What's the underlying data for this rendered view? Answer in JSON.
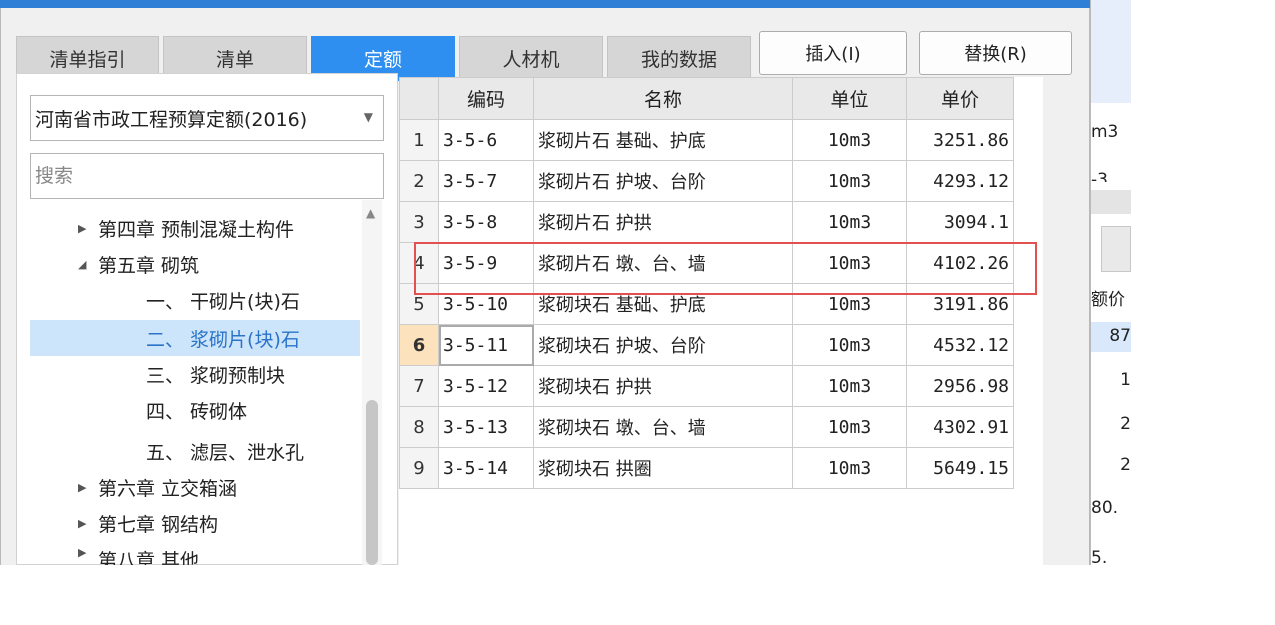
{
  "tabs": [
    {
      "label": "清单指引",
      "active": false
    },
    {
      "label": "清单",
      "active": false
    },
    {
      "label": "定额",
      "active": true
    },
    {
      "label": "人材机",
      "active": false
    },
    {
      "label": "我的数据",
      "active": false
    }
  ],
  "toolbar": {
    "insert_label": "插入(I)",
    "replace_label": "替换(R)"
  },
  "library_select": {
    "value": "河南省市政工程预算定额(2016)"
  },
  "search": {
    "placeholder": "搜索"
  },
  "tree": [
    {
      "label": "第四章 预制混凝土构件",
      "level": 1,
      "expander": "collapsed"
    },
    {
      "label": "第五章 砌筑",
      "level": 1,
      "expander": "expanded"
    },
    {
      "label": "一、 干砌片(块)石",
      "level": 2
    },
    {
      "label": "二、 浆砌片(块)石",
      "level": 2,
      "selected": true
    },
    {
      "label": "三、 浆砌预制块",
      "level": 2
    },
    {
      "label": "四、 砖砌体",
      "level": 2
    },
    {
      "label": "五、 滤层、泄水孔",
      "level": 2
    },
    {
      "label": "第六章 立交箱涵",
      "level": 1,
      "expander": "collapsed"
    },
    {
      "label": "第七章 钢结构",
      "level": 1,
      "expander": "collapsed"
    },
    {
      "label": "第八章 其他",
      "level": 1,
      "expander": "collapsed"
    }
  ],
  "table": {
    "headers": {
      "code": "编码",
      "name": "名称",
      "unit": "单位",
      "price": "单价"
    },
    "rows": [
      {
        "no": "1",
        "code": "3-5-6",
        "name": "浆砌片石 基础、护底",
        "unit": "10m3",
        "price": "3251.86"
      },
      {
        "no": "2",
        "code": "3-5-7",
        "name": "浆砌片石 护坡、台阶",
        "unit": "10m3",
        "price": "4293.12"
      },
      {
        "no": "3",
        "code": "3-5-8",
        "name": "浆砌片石 护拱",
        "unit": "10m3",
        "price": "3094.1"
      },
      {
        "no": "4",
        "code": "3-5-9",
        "name": "浆砌片石 墩、台、墙",
        "unit": "10m3",
        "price": "4102.26"
      },
      {
        "no": "5",
        "code": "3-5-10",
        "name": "浆砌块石 基础、护底",
        "unit": "10m3",
        "price": "3191.86"
      },
      {
        "no": "6",
        "code": "3-5-11",
        "name": "浆砌块石 护坡、台阶",
        "unit": "10m3",
        "price": "4532.12"
      },
      {
        "no": "7",
        "code": "3-5-12",
        "name": "浆砌块石 护拱",
        "unit": "10m3",
        "price": "2956.98"
      },
      {
        "no": "8",
        "code": "3-5-13",
        "name": "浆砌块石 墩、台、墙",
        "unit": "10m3",
        "price": "4302.91"
      },
      {
        "no": "9",
        "code": "3-5-14",
        "name": "浆砌块石 拱圈",
        "unit": "10m3",
        "price": "5649.15"
      }
    ],
    "current_row": "6",
    "highlighted_row": "4"
  },
  "right_panel": {
    "texts": [
      "m3",
      "-3",
      "额价",
      "87",
      "1",
      "2",
      "2",
      "80.",
      "5."
    ]
  },
  "colors": {
    "accent": "#2f8ff0",
    "selected_tree_bg": "#cde5fa",
    "highlight_border": "#e25050",
    "current_row_bg": "#fde3bd"
  }
}
